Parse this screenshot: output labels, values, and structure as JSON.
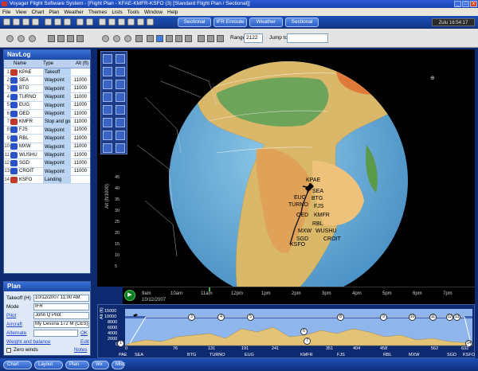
{
  "window": {
    "title": "Voyager Flight Software System - [Flight Plan - KFAE-KMFR-KSFO (3) [Standard Flight Plan / Sectional]]",
    "controls": [
      "_",
      "□",
      "x"
    ]
  },
  "menu": [
    "File",
    "View",
    "Chart",
    "Plan",
    "Weather",
    "Themes",
    "Lists",
    "Tools",
    "Window",
    "Help"
  ],
  "top_tabs": [
    "Sectional",
    "IFR Enroute",
    "Weather",
    "Sectional"
  ],
  "zulu": "Zulu 16:54:17",
  "map_toolbar": {
    "range_label": "Range",
    "range_value": "2122",
    "jump_label": "Jump to",
    "jump_value": ""
  },
  "navlog": {
    "title": "NavLog",
    "headers": {
      "name": "Name",
      "type": "Type",
      "alt": "Alt (ft)"
    },
    "rows": [
      {
        "num": "1",
        "ident": "KPAE",
        "type": "Takeoff",
        "alt": "",
        "icon_color": "#c0392b"
      },
      {
        "num": "2",
        "ident": "SEA",
        "type": "Waypoint",
        "alt": "11000",
        "icon_color": "#2952c8"
      },
      {
        "num": "3",
        "ident": "BTG",
        "type": "Waypoint",
        "alt": "11000",
        "icon_color": "#2952c8"
      },
      {
        "num": "4",
        "ident": "TURNO",
        "type": "Waypoint",
        "alt": "11000",
        "icon_color": "#2952c8"
      },
      {
        "num": "5",
        "ident": "EUG",
        "type": "Waypoint",
        "alt": "11000",
        "icon_color": "#2952c8"
      },
      {
        "num": "6",
        "ident": "OED",
        "type": "Waypoint",
        "alt": "11000",
        "icon_color": "#2952c8"
      },
      {
        "num": "7",
        "ident": "KMFR",
        "type": "Stop and go",
        "alt": "11000",
        "icon_color": "#c0392b"
      },
      {
        "num": "8",
        "ident": "FJS",
        "type": "Waypoint",
        "alt": "11000",
        "icon_color": "#2952c8"
      },
      {
        "num": "9",
        "ident": "RBL",
        "type": "Waypoint",
        "alt": "11000",
        "icon_color": "#2952c8"
      },
      {
        "num": "10",
        "ident": "MXW",
        "type": "Waypoint",
        "alt": "11000",
        "icon_color": "#2952c8"
      },
      {
        "num": "11",
        "ident": "WUSHU",
        "type": "Waypoint",
        "alt": "11000",
        "icon_color": "#2952c8"
      },
      {
        "num": "12",
        "ident": "SGD",
        "type": "Waypoint",
        "alt": "11000",
        "icon_color": "#2952c8"
      },
      {
        "num": "13",
        "ident": "CROIT",
        "type": "Waypoint",
        "alt": "11000",
        "icon_color": "#2952c8"
      },
      {
        "num": "14",
        "ident": "KSFO",
        "type": "Landing",
        "alt": "",
        "icon_color": "#c0392b"
      }
    ]
  },
  "plan": {
    "title": "Plan",
    "takeoff_label": "Takeoff (H)",
    "takeoff_value": "10/12/2007 11:00 AM",
    "mode_label": "Mode",
    "mode_value": "IFR",
    "pilot_label": "Pilot",
    "pilot_value": "John Q Pilot",
    "aircraft_label": "Aircraft",
    "aircraft_value": "My Cessna 172 M (CES)",
    "alternate_label": "Alternate",
    "ok_label": "OK",
    "wb_label": "Weight and balance",
    "edit_label": "Edit",
    "zero_winds_label": "Zero winds",
    "notes_label": "Notes"
  },
  "bottom_buttons": [
    "Chart",
    "Layout",
    "Plan",
    "Wx",
    "Misc"
  ],
  "map": {
    "route_labels": [
      "KPAE",
      "SEA",
      "EUG",
      "BTG",
      "TURNO",
      "FJS",
      "OED",
      "KMFR",
      "RBL",
      "MXW",
      "WUSHU",
      "SGD",
      "CROIT",
      "KSFO"
    ],
    "altitude_axis_label": "Alt (ft/1000)",
    "altitude_ticks": [
      "45",
      "40",
      "35",
      "30",
      "25",
      "20",
      "15",
      "10",
      "5"
    ]
  },
  "timeline": {
    "play_symbol": "▶",
    "date_label": "10/12/2007",
    "times": [
      "9am",
      "10am",
      "11am",
      "12pm",
      "1pm",
      "2pm",
      "3pm",
      "4pm",
      "5pm",
      "6pm",
      "7pm"
    ]
  },
  "profile": {
    "y_axis_label": "Alt (ft)",
    "y_ticks": [
      "15000",
      "10000",
      "8000",
      "6000",
      "4000",
      "2000",
      "0"
    ],
    "distance_ticks": [
      "0",
      "76",
      "131",
      "191",
      "241",
      "351",
      "404",
      "458",
      "562",
      "632"
    ],
    "waypoint_names": [
      "PAE",
      "SEA",
      "BTG",
      "TURNO",
      "EUG",
      "KMFR",
      "FJS",
      "RBL",
      "MXW",
      "SGD",
      "KSFO"
    ],
    "waypoint_markers": [
      "1",
      "2",
      "3",
      "4",
      "5",
      "6",
      "7",
      "8",
      "9",
      "10",
      "11",
      "12",
      "13",
      "14"
    ]
  }
}
